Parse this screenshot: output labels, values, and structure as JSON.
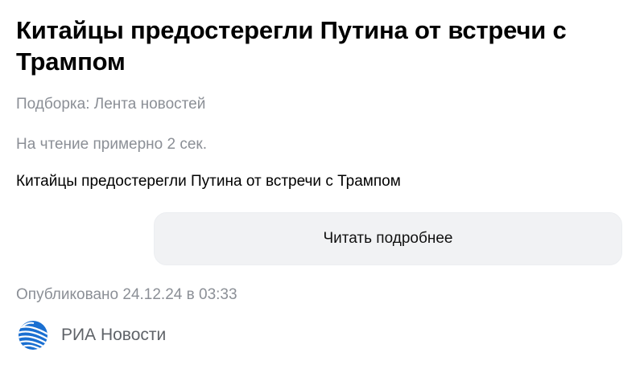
{
  "article": {
    "title": "Китайцы предостерегли Путина от встречи с Трампом",
    "collection": "Подборка: Лента новостей",
    "reading_time": "На чтение примерно 2 сек.",
    "summary": "Китайцы предостерегли Путина от встречи с Трампом",
    "read_more_label": "Читать подробнее",
    "published": "Опубликовано 24.12.24 в 03:33"
  },
  "source": {
    "name": "РИА Новости",
    "logo_icon": "ria-novosti-logo-icon",
    "logo_color": "#1a6fd1"
  },
  "colors": {
    "meta_text": "#8b8f96",
    "button_bg": "#f1f2f4"
  }
}
